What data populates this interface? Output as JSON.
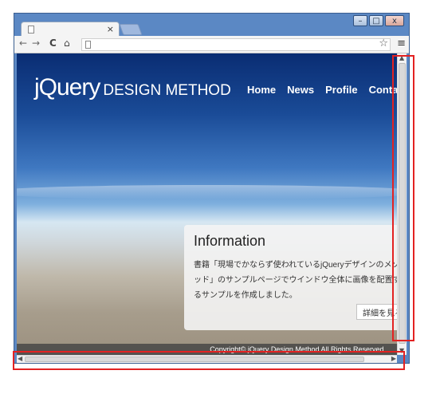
{
  "browser": {
    "tab_close": "×",
    "window_controls": {
      "minimize": "–",
      "maximize": "□",
      "close": "x"
    },
    "toolbar": {
      "back": "←",
      "forward": "→",
      "reload": "C",
      "home": "⌂",
      "star": "☆",
      "menu": "≡"
    }
  },
  "site": {
    "logo_main": "jQuery",
    "logo_sub": "DESIGN METHOD",
    "nav": [
      "Home",
      "News",
      "Profile",
      "Contact"
    ],
    "info": {
      "title": "Information",
      "body": "書籍「現場でかならず使われているjQueryデザインのメソッド」のサンプルページでウインドウ全体に画像を配置するサンプルを作成しました。",
      "button": "詳細を見る"
    },
    "footer": "Copyright© jQuery Design Method All Rights Reserved."
  },
  "colors": {
    "highlight": "#e32222",
    "chrome_frame": "#5b88c4"
  }
}
